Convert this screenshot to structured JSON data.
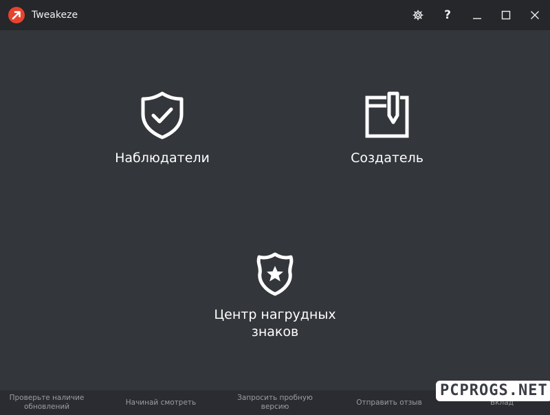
{
  "window": {
    "title": "Tweakeze",
    "logo_icon": "tweakeze-logo-icon",
    "controls": {
      "settings_icon": "gear-icon",
      "help_label": "?",
      "minimize_icon": "minimize-icon",
      "maximize_icon": "maximize-icon",
      "close_icon": "close-icon"
    }
  },
  "tiles": [
    {
      "label": "Наблюдатели",
      "icon": "shield-check-icon"
    },
    {
      "label": "Создатель",
      "icon": "document-pen-icon"
    },
    {
      "label": "Центр нагрудных\nзнаков",
      "icon": "badge-star-icon"
    }
  ],
  "footer": {
    "links": [
      "Проверьте наличие\nобновлений",
      "Начинай смотреть",
      "Запросить пробную\nверсию",
      "Отправить отзыв",
      "Вклад"
    ]
  },
  "watermark": "PCPROGS.NET",
  "colors": {
    "background": "#33363b",
    "titlebar": "#25272b",
    "footer": "#2a2c31",
    "logo_red": "#e8432e",
    "text": "#ffffff",
    "footer_text": "#9a9da3"
  }
}
